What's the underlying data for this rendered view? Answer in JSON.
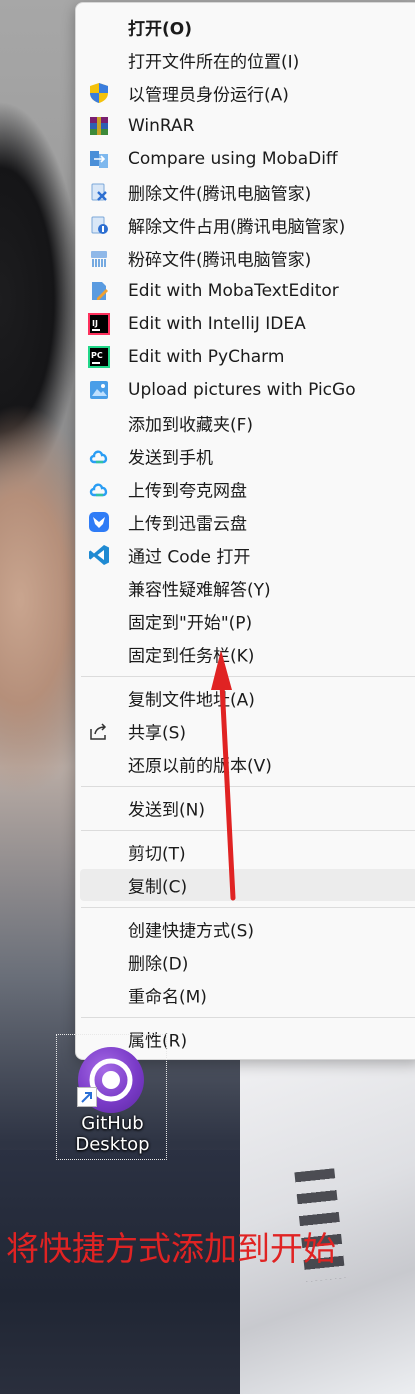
{
  "menu": {
    "items": [
      {
        "label": "打开(O)",
        "icon": ""
      },
      {
        "label": "打开文件所在的位置(I)",
        "icon": ""
      },
      {
        "label": "以管理员身份运行(A)",
        "icon": "uac-shield-icon"
      },
      {
        "label": "WinRAR",
        "icon": "winrar-icon"
      },
      {
        "label": "Compare using MobaDiff",
        "icon": "mobadiff-icon"
      },
      {
        "label": "删除文件(腾讯电脑管家)",
        "icon": "delete-file-icon"
      },
      {
        "label": "解除文件占用(腾讯电脑管家)",
        "icon": "unlock-file-icon"
      },
      {
        "label": "粉碎文件(腾讯电脑管家)",
        "icon": "shred-file-icon"
      },
      {
        "label": "Edit with MobaTextEditor",
        "icon": "mobatexteditor-icon"
      },
      {
        "label": "Edit with IntelliJ IDEA",
        "icon": "intellij-icon"
      },
      {
        "label": "Edit with PyCharm",
        "icon": "pycharm-icon"
      },
      {
        "label": "Upload pictures with PicGo",
        "icon": "picgo-icon"
      },
      {
        "label": "添加到收藏夹(F)",
        "icon": ""
      },
      {
        "label": "发送到手机",
        "icon": "cloud-icon"
      },
      {
        "label": "上传到夸克网盘",
        "icon": "cloud-icon"
      },
      {
        "label": "上传到迅雷云盘",
        "icon": "xunlei-icon"
      },
      {
        "label": "通过 Code 打开",
        "icon": "vscode-icon"
      },
      {
        "label": "兼容性疑难解答(Y)",
        "icon": ""
      },
      {
        "label": "固定到\"开始\"(P)",
        "icon": ""
      },
      {
        "label": "固定到任务栏(K)",
        "icon": ""
      },
      {
        "label": "复制文件地址(A)",
        "icon": ""
      },
      {
        "label": "共享(S)",
        "icon": "share-icon"
      },
      {
        "label": "还原以前的版本(V)",
        "icon": ""
      },
      {
        "label": "发送到(N)",
        "icon": ""
      },
      {
        "label": "剪切(T)",
        "icon": ""
      },
      {
        "label": "复制(C)",
        "icon": ""
      },
      {
        "label": "创建快捷方式(S)",
        "icon": ""
      },
      {
        "label": "删除(D)",
        "icon": ""
      },
      {
        "label": "重命名(M)",
        "icon": ""
      },
      {
        "label": "属性(R)",
        "icon": ""
      }
    ]
  },
  "desktop_icon": {
    "line1": "GitHub",
    "line2": "Desktop",
    "icon": "github-desktop-icon"
  },
  "annotation": "将快捷方式添加到开始",
  "colors": {
    "annotation": "#e02323",
    "menu_bg": "#f9f9f9",
    "hover": "#ececec"
  }
}
